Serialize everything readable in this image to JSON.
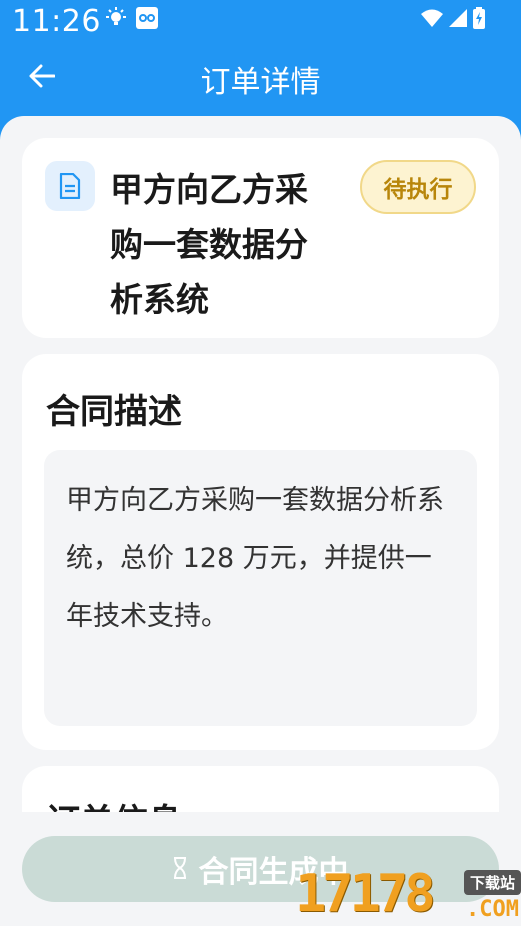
{
  "status_bar": {
    "time": "11:26",
    "icons": [
      "bulb-icon",
      "app-icon",
      "wifi-icon",
      "signal-icon",
      "battery-icon"
    ]
  },
  "app_bar": {
    "title": "订单详情",
    "back_icon": "arrow-left-icon"
  },
  "header_card": {
    "icon": "document-icon",
    "title": "甲方向乙方采购一套数据分析系统",
    "status_badge": "待执行"
  },
  "description_card": {
    "section_title": "合同描述",
    "text": "甲方向乙方采购一套数据分析系统，总价 128 万元，并提供一年技术支持。"
  },
  "order_card": {
    "section_title": "订单信息"
  },
  "bottom": {
    "button_label": "合同生成中",
    "button_icon": "hourglass-icon"
  },
  "watermark": {
    "number": "17178",
    "tag": "下载站",
    "suffix": ".COM"
  },
  "colors": {
    "primary": "#2196F3",
    "background": "#F4F5F7",
    "badge_bg": "#FDF3D1",
    "badge_text": "#B8860B",
    "button_disabled": "#CADBD6"
  }
}
